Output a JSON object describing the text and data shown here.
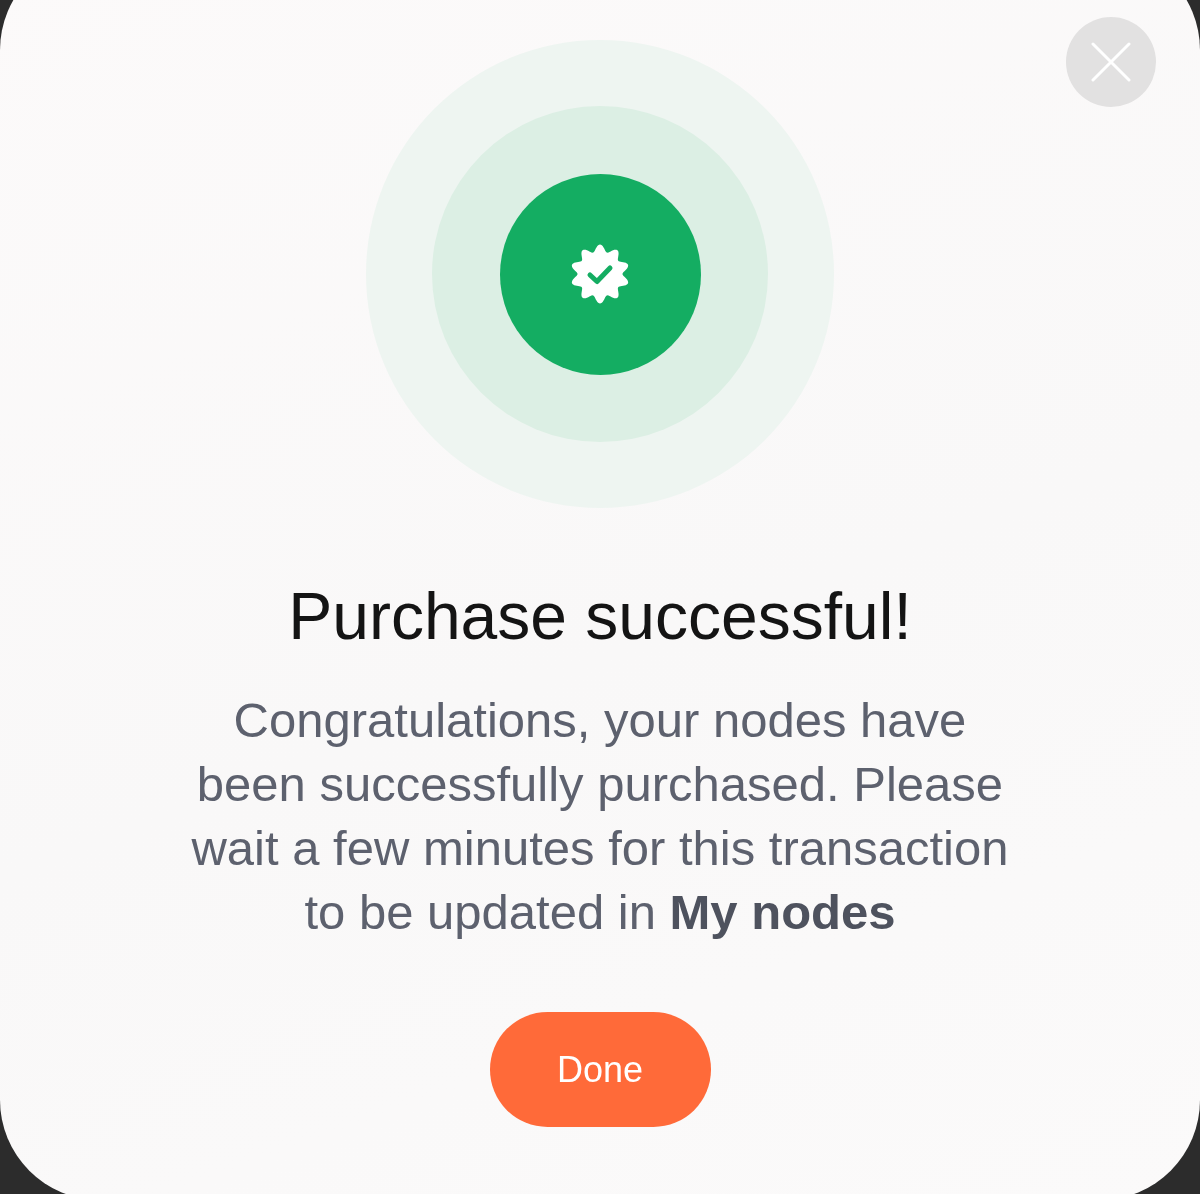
{
  "dialog": {
    "title": "Purchase successful!",
    "message": "Congratulations, your nodes have been successfully purchased. Please wait a few minutes for this transaction to be updated in **My nodes**",
    "button": "Done"
  }
}
